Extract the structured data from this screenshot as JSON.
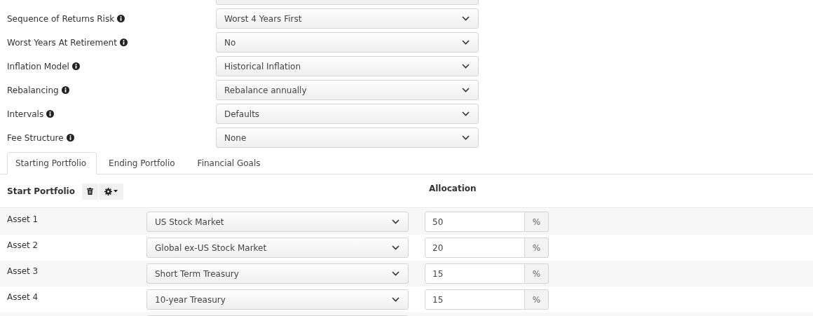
{
  "settings": [
    {
      "label": "Sequence of Returns Risk",
      "value": "Worst 4 Years First"
    },
    {
      "label": "Worst Years At Retirement",
      "value": "No"
    },
    {
      "label": "Inflation Model",
      "value": "Historical Inflation"
    },
    {
      "label": "Rebalancing",
      "value": "Rebalance annually"
    },
    {
      "label": "Intervals",
      "value": "Defaults"
    },
    {
      "label": "Fee Structure",
      "value": "None"
    }
  ],
  "tabs": [
    {
      "label": "Starting Portfolio",
      "selected": true
    },
    {
      "label": "Ending Portfolio",
      "selected": false
    },
    {
      "label": "Financial Goals",
      "selected": false
    }
  ],
  "portfolio": {
    "title": "Start Portfolio",
    "allocation_header": "Allocation",
    "assets": [
      {
        "label": "Asset 1",
        "value": "US Stock Market",
        "allocation": "50",
        "unit": "%"
      },
      {
        "label": "Asset 2",
        "value": "Global ex-US Stock Market",
        "allocation": "20",
        "unit": "%"
      },
      {
        "label": "Asset 3",
        "value": "Short Term Treasury",
        "allocation": "15",
        "unit": "%"
      },
      {
        "label": "Asset 4",
        "value": "10-year Treasury",
        "allocation": "15",
        "unit": "%"
      }
    ]
  }
}
